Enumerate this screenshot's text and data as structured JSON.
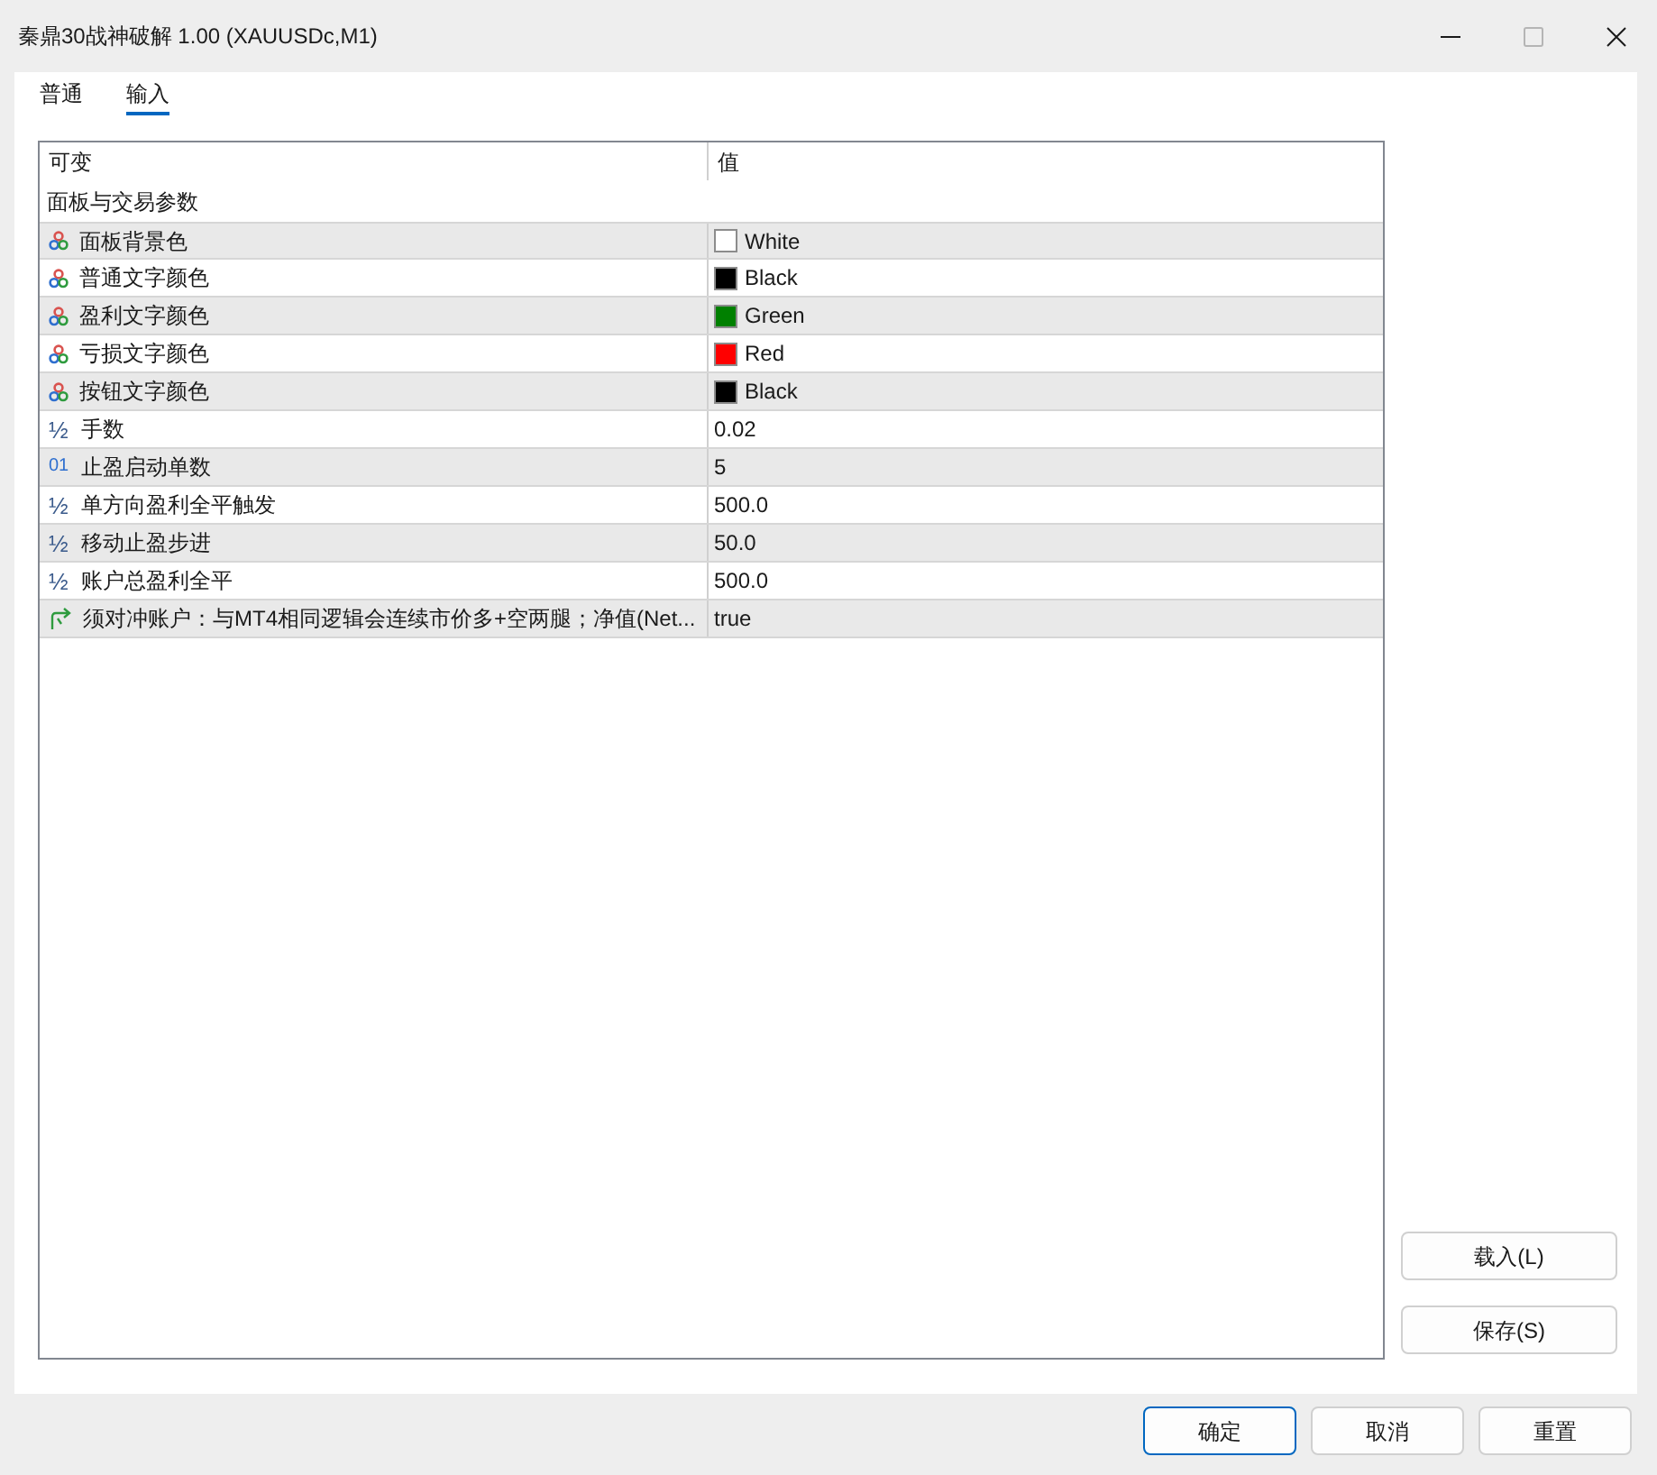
{
  "window": {
    "title": "秦鼎30战神破解 1.00 (XAUUSDc,M1)"
  },
  "tabs": [
    {
      "label": "普通",
      "selected": false
    },
    {
      "label": "输入",
      "selected": true
    }
  ],
  "table": {
    "columns": [
      "可变",
      "值"
    ],
    "group": "面板与交易参数",
    "rows": [
      {
        "kind": "color",
        "name": "面板背景色",
        "value": "White",
        "color": "#ffffff"
      },
      {
        "kind": "color",
        "name": "普通文字颜色",
        "value": "Black",
        "color": "#000000"
      },
      {
        "kind": "color",
        "name": "盈利文字颜色",
        "value": "Green",
        "color": "#008000"
      },
      {
        "kind": "color",
        "name": "亏损文字颜色",
        "value": "Red",
        "color": "#ff0000"
      },
      {
        "kind": "color",
        "name": "按钮文字颜色",
        "value": "Black",
        "color": "#000000"
      },
      {
        "kind": "double",
        "icon": "½",
        "name": "手数",
        "value": "0.02"
      },
      {
        "kind": "int",
        "icon": "01",
        "name": "止盈启动单数",
        "value": "5"
      },
      {
        "kind": "double",
        "icon": "½",
        "name": "单方向盈利全平触发",
        "value": "500.0"
      },
      {
        "kind": "double",
        "icon": "½",
        "name": "移动止盈步进",
        "value": "50.0"
      },
      {
        "kind": "double",
        "icon": "½",
        "name": "账户总盈利全平",
        "value": "500.0"
      },
      {
        "kind": "bool",
        "name": "须对冲账户：与MT4相同逻辑会连续市价多+空两腿；净值(Net...",
        "value": "true"
      }
    ]
  },
  "side_buttons": [
    {
      "label": "载入(L)"
    },
    {
      "label": "保存(S)"
    }
  ],
  "footer_buttons": [
    {
      "label": "确定",
      "default": true
    },
    {
      "label": "取消",
      "default": false
    },
    {
      "label": "重置",
      "default": false
    }
  ]
}
